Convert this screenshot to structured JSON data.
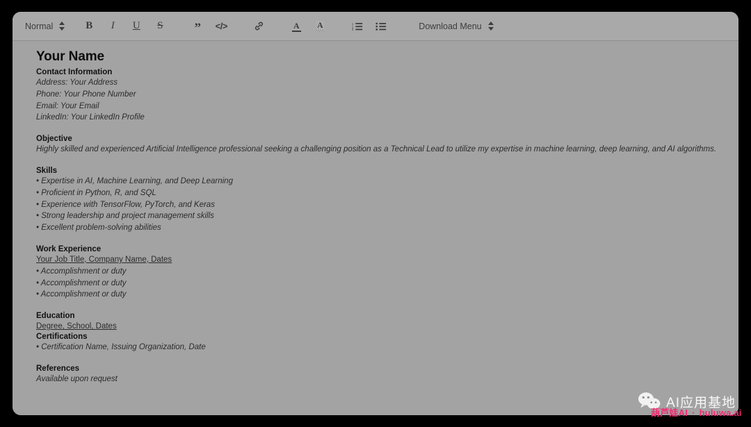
{
  "toolbar": {
    "style_picker": {
      "label": "Normal",
      "icon": "chevron-up-down-icon"
    },
    "buttons": [
      {
        "name": "bold-button",
        "glyph": "B",
        "title": "Bold"
      },
      {
        "name": "italic-button",
        "glyph": "I",
        "title": "Italic"
      },
      {
        "name": "underline-button",
        "glyph": "U",
        "title": "Underline"
      },
      {
        "name": "strikethrough-button",
        "glyph": "S",
        "title": "Strikethrough"
      },
      {
        "name": "blockquote-button",
        "glyph": "”",
        "title": "Blockquote"
      },
      {
        "name": "code-block-button",
        "glyph": "</>",
        "title": "Code block"
      },
      {
        "name": "link-button",
        "glyph": "🔗",
        "title": "Link"
      },
      {
        "name": "text-color-button",
        "glyph": "A",
        "title": "Text color"
      },
      {
        "name": "background-color-button",
        "glyph": "A",
        "title": "Background color"
      },
      {
        "name": "ordered-list-button",
        "glyph": "",
        "title": "Ordered list"
      },
      {
        "name": "bullet-list-button",
        "glyph": "",
        "title": "Bullet list"
      }
    ],
    "download_picker": {
      "label": "Download Menu",
      "icon": "chevron-up-down-icon"
    }
  },
  "document": {
    "name": "Your Name",
    "sections": [
      {
        "heading": "Contact Information",
        "lines": [
          "Address: Your Address",
          "Phone: Your Phone Number",
          "Email: Your Email",
          "LinkedIn: Your LinkedIn Profile"
        ]
      },
      {
        "heading": "Objective",
        "lines": [
          "Highly skilled and experienced Artificial Intelligence professional seeking a challenging position as a Technical Lead to utilize my expertise in machine learning, deep learning, and AI algorithms."
        ]
      },
      {
        "heading": "Skills",
        "lines": [
          "• Expertise in AI, Machine Learning, and Deep Learning",
          "• Proficient in Python, R, and SQL",
          "• Experience with TensorFlow, PyTorch, and Keras",
          "• Strong leadership and project management skills",
          "• Excellent problem-solving abilities"
        ]
      },
      {
        "heading": "Work Experience",
        "subheading": "Your Job Title, Company Name, Dates",
        "lines": [
          "• Accomplishment or duty",
          "• Accomplishment or duty",
          "• Accomplishment or duty"
        ]
      },
      {
        "heading": "Education",
        "subheading": "Degree, School, Dates",
        "lines": []
      },
      {
        "heading": "Certifications",
        "lines": [
          "• Certification Name, Issuing Organization, Date"
        ]
      },
      {
        "heading": "References",
        "lines": [
          "Available upon request"
        ]
      }
    ]
  },
  "watermark": {
    "logo": "wechat-icon",
    "title": "AI应用基地",
    "brand": "葫芦娃AI",
    "separator": "·",
    "site": "huluwa.ai",
    "accent_color": "#ef2d71"
  }
}
